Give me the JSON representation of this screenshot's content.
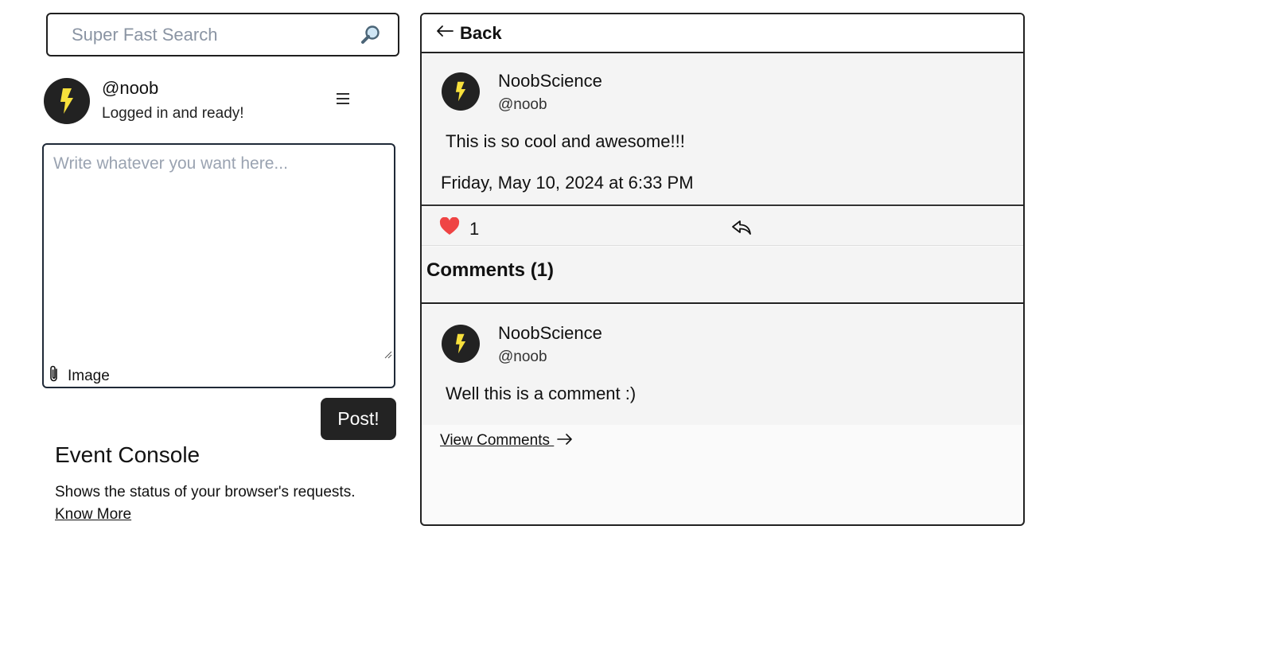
{
  "search": {
    "placeholder": "Super Fast Search",
    "icon": "magnifier-icon"
  },
  "profile": {
    "handle": "@noob",
    "status": "Logged in and ready!",
    "avatar_icon": "lightning-bolt-icon",
    "menu_icon": "hamburger-menu-icon"
  },
  "composer": {
    "placeholder": "Write whatever you want here...",
    "attach_label": "Image",
    "attach_icon": "paperclip-icon",
    "post_label": "Post!"
  },
  "console": {
    "title": "Event Console",
    "description": "Shows the status of your browser's requests.",
    "link_label": "Know More"
  },
  "panel": {
    "back_label": "Back",
    "post": {
      "author_name": "NoobScience",
      "author_handle": "@noob",
      "text": "This is so cool and awesome!!!",
      "date": "Friday, May 10, 2024 at 6:33 PM",
      "like_count": "1"
    },
    "comments_title": "Comments (1)",
    "comments": [
      {
        "author_name": "NoobScience",
        "author_handle": "@noob",
        "text": "Well this is a comment :)"
      }
    ],
    "view_comments_label": "View Comments "
  },
  "colors": {
    "avatar_bg": "#222222",
    "bolt": "#f7e03c",
    "heart": "#ef4444",
    "button_bg": "#232323"
  }
}
